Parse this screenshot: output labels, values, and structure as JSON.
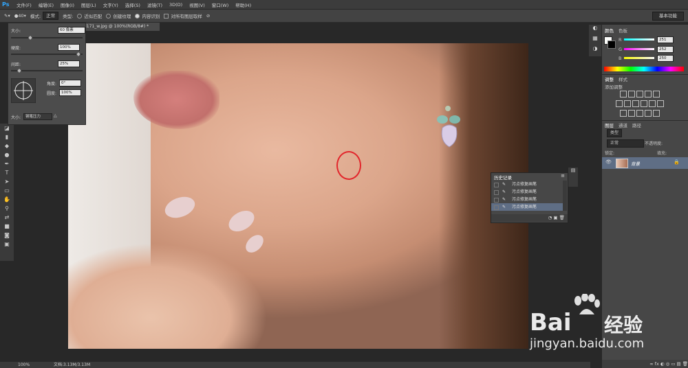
{
  "menubar": {
    "logo": "Ps",
    "items": [
      "文件(F)",
      "编辑(E)",
      "图像(I)",
      "图层(L)",
      "文字(Y)",
      "选择(S)",
      "滤镜(T)",
      "3D(D)",
      "视图(V)",
      "窗口(W)",
      "帮助(H)"
    ]
  },
  "options": {
    "brush_size": "40",
    "mode_label": "模式:",
    "mode_value": "正常",
    "type_label": "类型:",
    "type_options": [
      "近似匹配",
      "创建纹理",
      "内容识别"
    ],
    "type_selected": "内容识别",
    "sample_all_label": "对所有图层取样",
    "workspace": "基本功能"
  },
  "document": {
    "tab_title": "d171_w.jpg @ 100%(RGB/8#) *"
  },
  "brush_panel": {
    "size_label": "大小:",
    "size_value": "60 像素",
    "hardness_label": "硬度:",
    "hardness_value": "100%",
    "spacing_label": "间距:",
    "spacing_value": "25%",
    "angle_label": "角度:",
    "angle_value": "0°",
    "roundness_label": "圆度:",
    "roundness_value": "100%",
    "size_control_label": "大小:",
    "size_control_value": "钢笔压力"
  },
  "color_panel": {
    "tabs": [
      "颜色",
      "色板"
    ],
    "r_label": "R",
    "r_value": "251",
    "g_label": "G",
    "g_value": "252",
    "b_label": "B",
    "b_value": "250"
  },
  "adjust_panel": {
    "tabs": [
      "调整",
      "样式"
    ],
    "title": "添加调整"
  },
  "layers_panel": {
    "tabs": [
      "图层",
      "通道",
      "路径"
    ],
    "kind_label": "类型",
    "blend_mode": "正常",
    "opacity_label": "不透明度:",
    "lock_label": "锁定:",
    "fill_label": "填充:",
    "layer_name": "背景"
  },
  "history_panel": {
    "title": "历史记录",
    "rows": [
      "污点修复画笔",
      "污点修复画笔",
      "污点修复画笔",
      "污点修复画笔"
    ]
  },
  "statusbar": {
    "zoom": "100%",
    "doc_info": "文档:3.13M/3.13M"
  },
  "watermark": {
    "brand": "Bai",
    "brand2": "经验",
    "url": "jingyan.baidu.com"
  },
  "colors": {
    "accent_ps": "#31a8ff",
    "spot_circle": "#e2262c"
  }
}
